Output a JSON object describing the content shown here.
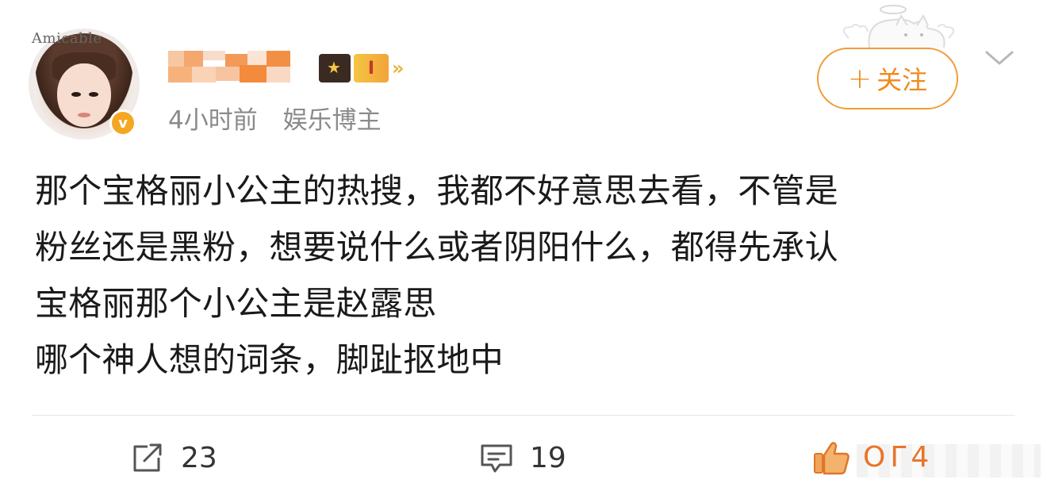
{
  "post": {
    "avatar_text": "Amicable",
    "verified_mark": "v",
    "time": "4小时前",
    "user_type": "娱乐博主",
    "follow_label": "关注",
    "follow_plus": "+",
    "lines": [
      "那个宝格丽小公主的热搜，我都不好意思去看，不管是",
      "粉丝还是黑粉，想要说什么或者阴阳什么，都得先承认",
      "宝格丽那个小公主是赵露思",
      "哪个神人想的词条，脚趾抠地中"
    ]
  },
  "badges": {
    "level_label": "I",
    "arrow": "»"
  },
  "actions": {
    "repost_count": "23",
    "comment_count": "19",
    "like_count_partial": "OΓ4"
  },
  "colors": {
    "accent": "#f08a1d",
    "text": "#1a1a1a",
    "meta": "#8a8a8a",
    "like": "#e8752a"
  },
  "icons": {
    "repost": "share-box-icon",
    "comment": "message-icon",
    "like": "thumbs-up-icon",
    "menu": "chevron-down-icon"
  }
}
